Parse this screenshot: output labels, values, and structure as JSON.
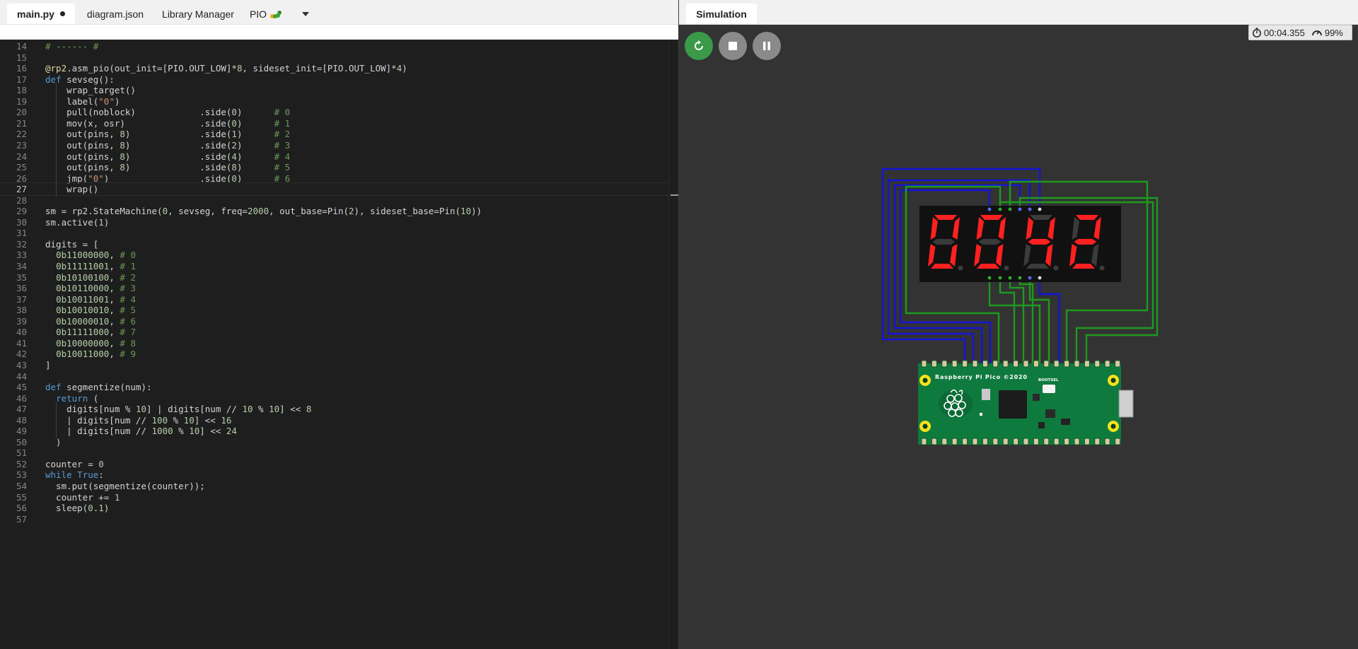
{
  "editor": {
    "tabs": [
      {
        "label": "main.py",
        "active": true,
        "unsaved": true
      },
      {
        "label": "diagram.json"
      },
      {
        "label": "Library Manager"
      },
      {
        "label": "PIO"
      }
    ],
    "pio_icon": "caterpillar-icon",
    "tabs_menu_icon": "chevron-down-icon",
    "current_line": 27,
    "code_lines": [
      {
        "n": "14",
        "t": "# ------ #"
      },
      {
        "n": "15",
        "t": ""
      },
      {
        "n": "16",
        "t": "@rp2.asm_pio(out_init=[PIO.OUT_LOW]*8, sideset_init=[PIO.OUT_LOW]*4)"
      },
      {
        "n": "17",
        "t": "def sevseg():"
      },
      {
        "n": "18",
        "t": "    wrap_target()"
      },
      {
        "n": "19",
        "t": "    label(\"0\")"
      },
      {
        "n": "20",
        "t": "    pull(noblock)            .side(0)      # 0"
      },
      {
        "n": "21",
        "t": "    mov(x, osr)              .side(0)      # 1"
      },
      {
        "n": "22",
        "t": "    out(pins, 8)             .side(1)      # 2"
      },
      {
        "n": "23",
        "t": "    out(pins, 8)             .side(2)      # 3"
      },
      {
        "n": "24",
        "t": "    out(pins, 8)             .side(4)      # 4"
      },
      {
        "n": "25",
        "t": "    out(pins, 8)             .side(8)      # 5"
      },
      {
        "n": "26",
        "t": "    jmp(\"0\")                 .side(0)      # 6"
      },
      {
        "n": "27",
        "t": "    wrap()"
      },
      {
        "n": "28",
        "t": ""
      },
      {
        "n": "29",
        "t": "sm = rp2.StateMachine(0, sevseg, freq=2000, out_base=Pin(2), sideset_base=Pin(10))"
      },
      {
        "n": "30",
        "t": "sm.active(1)"
      },
      {
        "n": "31",
        "t": ""
      },
      {
        "n": "32",
        "t": "digits = ["
      },
      {
        "n": "33",
        "t": "  0b11000000, # 0"
      },
      {
        "n": "34",
        "t": "  0b11111001, # 1"
      },
      {
        "n": "35",
        "t": "  0b10100100, # 2"
      },
      {
        "n": "36",
        "t": "  0b10110000, # 3"
      },
      {
        "n": "37",
        "t": "  0b10011001, # 4"
      },
      {
        "n": "38",
        "t": "  0b10010010, # 5"
      },
      {
        "n": "39",
        "t": "  0b10000010, # 6"
      },
      {
        "n": "40",
        "t": "  0b11111000, # 7"
      },
      {
        "n": "41",
        "t": "  0b10000000, # 8"
      },
      {
        "n": "42",
        "t": "  0b10011000, # 9"
      },
      {
        "n": "43",
        "t": "]"
      },
      {
        "n": "44",
        "t": ""
      },
      {
        "n": "45",
        "t": "def segmentize(num):"
      },
      {
        "n": "46",
        "t": "  return ("
      },
      {
        "n": "47",
        "t": "    digits[num % 10] | digits[num // 10 % 10] << 8"
      },
      {
        "n": "48",
        "t": "    | digits[num // 100 % 10] << 16"
      },
      {
        "n": "49",
        "t": "    | digits[num // 1000 % 10] << 24"
      },
      {
        "n": "50",
        "t": "  )"
      },
      {
        "n": "51",
        "t": ""
      },
      {
        "n": "52",
        "t": "counter = 0"
      },
      {
        "n": "53",
        "t": "while True:"
      },
      {
        "n": "54",
        "t": "  sm.put(segmentize(counter));"
      },
      {
        "n": "55",
        "t": "  counter += 1"
      },
      {
        "n": "56",
        "t": "  sleep(0.1)"
      },
      {
        "n": "57",
        "t": ""
      }
    ]
  },
  "simulation": {
    "tab_label": "Simulation",
    "controls": [
      {
        "name": "restart-button",
        "icon": "restart-icon"
      },
      {
        "name": "stop-button",
        "icon": "stop-icon"
      },
      {
        "name": "pause-button",
        "icon": "pause-icon"
      }
    ],
    "timer_icon": "stopwatch-icon",
    "timer": "00:04.355",
    "speed_icon": "speedometer-icon",
    "speed": "99%",
    "display_digits": [
      "0",
      "0",
      "4",
      "2"
    ],
    "pico_label": "Raspberry Pi Pico ©2020",
    "bootsel_label": "BOOTSEL",
    "colors": {
      "segment_on": "#ff2020",
      "segment_off": "#3b3b3b",
      "wire_blue": "#1414d8",
      "wire_green": "#1e9a1e",
      "board": "#0f7a3e",
      "accent_green": "#3a9a4a"
    }
  }
}
